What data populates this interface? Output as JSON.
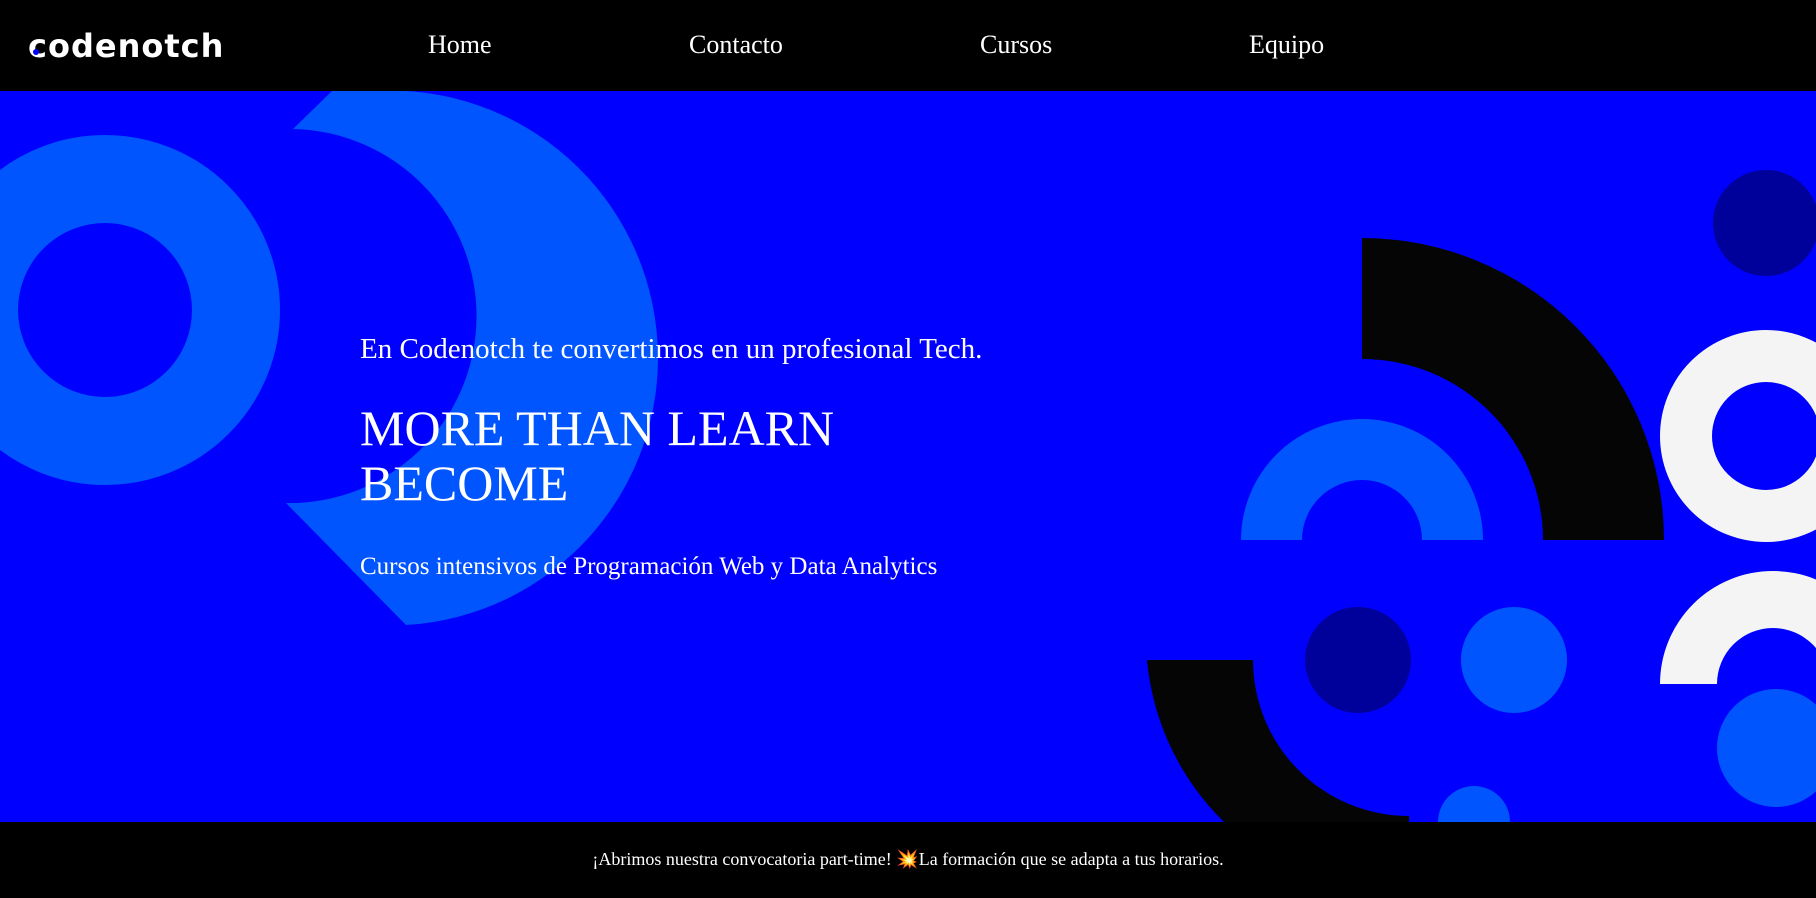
{
  "header": {
    "logo_text": "codenotch",
    "nav": [
      {
        "label": "Home"
      },
      {
        "label": "Contacto"
      },
      {
        "label": "Cursos"
      },
      {
        "label": "Equipo"
      }
    ]
  },
  "hero": {
    "tagline": "En Codenotch te convertimos en un profesional Tech.",
    "headline_line1": "MORE THAN LEARN",
    "headline_line2": "BECOME",
    "subtitle": "Cursos intensivos de Programación Web y Data Analytics"
  },
  "banner": {
    "text_before": "¡Abrimos nuestra convocatoria part-time! ",
    "icon": "💥",
    "icon_name": "collision-icon",
    "text_after": "La formación que se adapta a tus horarios."
  },
  "colors": {
    "hero_background": "#0000ff",
    "header_background": "#000000",
    "shape_light_blue": "#0055ff",
    "shape_navy": "#00009a",
    "shape_black": "#050505",
    "shape_white": "#f4f4f4"
  }
}
